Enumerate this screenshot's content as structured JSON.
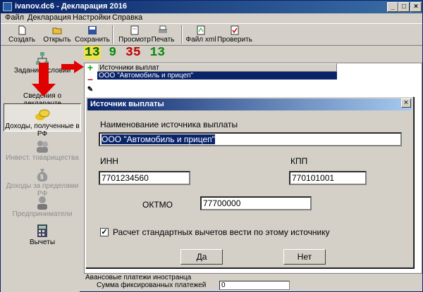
{
  "window": {
    "title": "ivanov.dc6 - Декларация 2016"
  },
  "menu": [
    "Файл",
    "Декларация",
    "Настройки",
    "Справка"
  ],
  "toolbar": {
    "create": "Создать",
    "open": "Открыть",
    "save": "Сохранить",
    "preview": "Просмотр",
    "print": "Печать",
    "xml": "Файл xml",
    "check": "Проверить"
  },
  "sidebar": {
    "items": [
      "Задание условий",
      "Сведения о декларанте",
      "Доходы, полученные в РФ",
      "Инвест. товарищества",
      "Доходы за пределами РФ",
      "Предприниматели",
      "Вычеты"
    ]
  },
  "digits": [
    "13",
    "9",
    "35",
    "13"
  ],
  "list": {
    "header": "Источники выплат",
    "rows": [
      "ООО \"Автомобиль и прицеп\""
    ]
  },
  "dialog": {
    "title": "Источник выплаты",
    "name_label": "Наименование источника выплаты",
    "name_value": "ООО \"Автомобиль и прицеп\"",
    "inn_label": "ИНН",
    "inn_value": "7701234560",
    "kpp_label": "КПП",
    "kpp_value": "770101001",
    "oktmo_label": "ОКТМО",
    "oktmo_value": "77700000",
    "checkbox_label": "Расчет стандартных вычетов вести по этому источнику",
    "checkbox_checked": true,
    "ok": "Да",
    "cancel": "Нет"
  },
  "bottom": {
    "line1": "Авансовые платежи иностранца",
    "line2": "Сумма фиксированных платежей",
    "value": "0"
  }
}
